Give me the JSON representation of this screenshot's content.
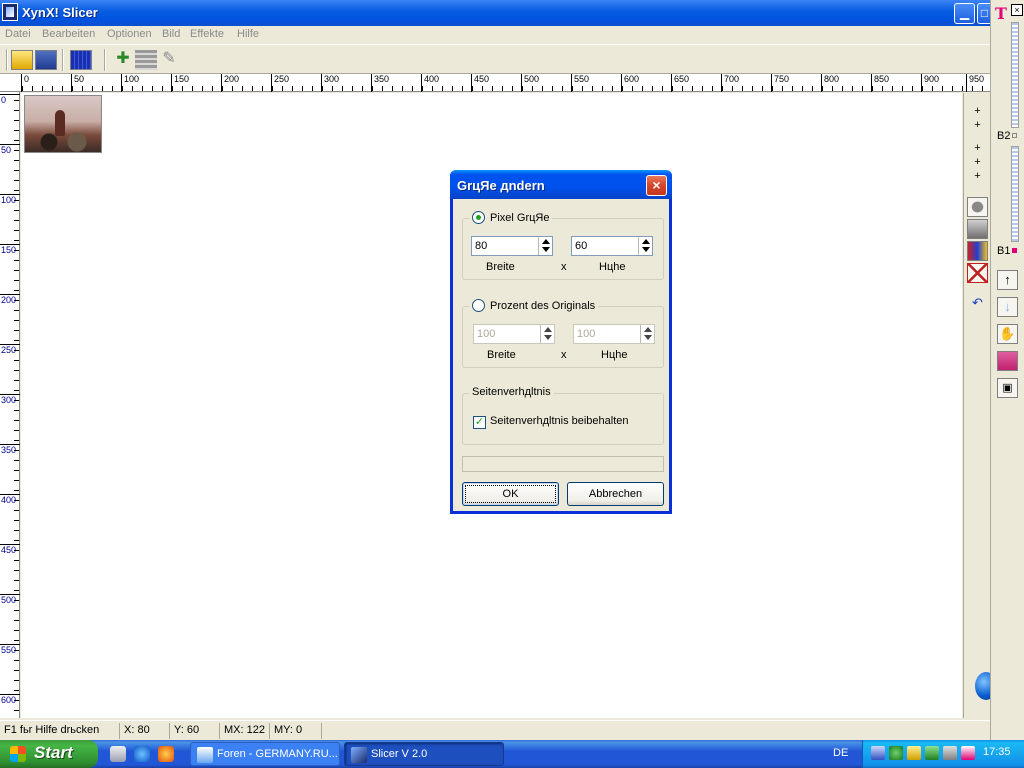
{
  "window": {
    "title": "XynX! Slicer",
    "min_glyph": "▁",
    "max_glyph": "□"
  },
  "menu": [
    "Datei",
    "Bearbeiten",
    "Optionen",
    "Bild",
    "Effekte",
    "Hilfe"
  ],
  "ruler": {
    "h_ticks": [
      "0",
      "50",
      "100",
      "150",
      "200",
      "250",
      "300",
      "350",
      "400",
      "450",
      "500",
      "550",
      "600",
      "650",
      "700",
      "750",
      "800",
      "850",
      "900",
      "950"
    ],
    "v_ticks": [
      "0",
      "50",
      "100",
      "150",
      "200",
      "250",
      "300",
      "350",
      "400",
      "450",
      "500",
      "550",
      "600"
    ]
  },
  "right_panel": {
    "plus": "+",
    "undo": "↶"
  },
  "sidebar": {
    "logo": "T",
    "close": "×",
    "b2_label": "B2",
    "b1_label": "B1",
    "b1_color": "#e20074"
  },
  "dialog": {
    "title": "GrцЯe дndern",
    "close_glyph": "×",
    "pixel_group": {
      "label": "Pixel GrцЯe",
      "selected": true,
      "width_value": "80",
      "height_value": "60",
      "width_label": "Breite",
      "height_label": "Hцhe",
      "times": "x"
    },
    "percent_group": {
      "label": "Prozent des Originals",
      "selected": false,
      "width_value": "100",
      "height_value": "100",
      "width_label": "Breite",
      "height_label": "Hцhe",
      "times": "x"
    },
    "aspect_group": {
      "label": "Seitenverhдltnis",
      "checkbox_label": "Seitenverhдltnis beibehalten",
      "checked": true,
      "check_glyph": "✓"
    },
    "ok_label": "OK",
    "cancel_label": "Abbrechen"
  },
  "status": {
    "help": "F1 fьr Hilfe drьcken",
    "x": "X: 80",
    "y": "Y: 60",
    "mx": "MX: 122",
    "my": "MY: 0"
  },
  "taskbar": {
    "start_label": "Start",
    "tasks": [
      {
        "label": "Foren - GERMANY.RU..."
      },
      {
        "label": "Slicer V 2.0"
      }
    ],
    "language": "DE",
    "clock": "17:35"
  },
  "colors": {
    "xp_blue": "#0054e3",
    "start_green": "#3c9a3c",
    "telekom_magenta": "#e20074",
    "tray_blue": "#1290e9"
  }
}
